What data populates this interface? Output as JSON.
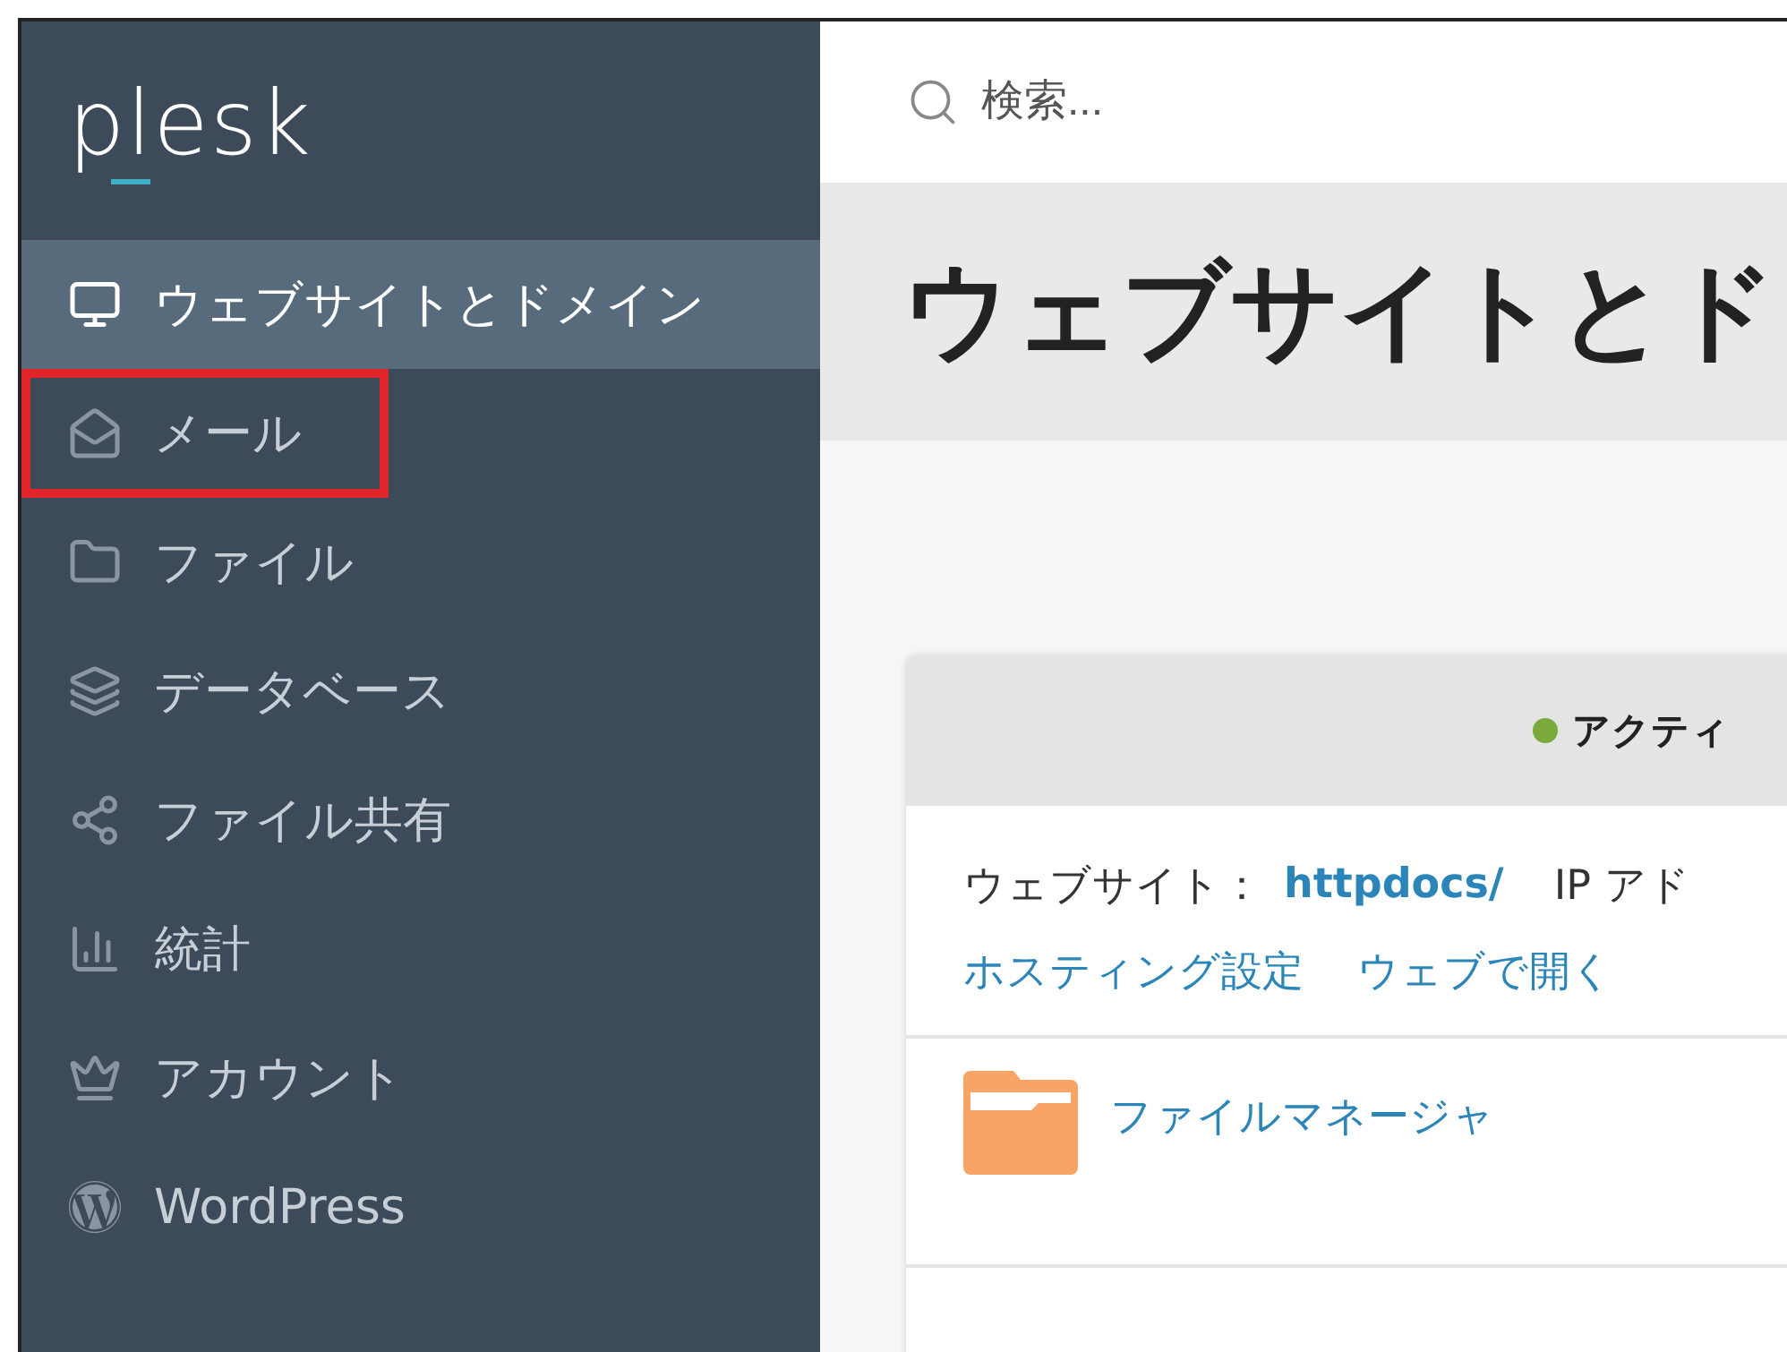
{
  "logo": "plesk",
  "search": {
    "placeholder": "検索..."
  },
  "sidebar": {
    "items": [
      {
        "label": "ウェブサイトとドメイン",
        "kind": "monitor",
        "selected": true,
        "highlighted": false
      },
      {
        "label": "メール",
        "kind": "mail",
        "selected": false,
        "highlighted": true
      },
      {
        "label": "ファイル",
        "kind": "folder",
        "selected": false,
        "highlighted": false
      },
      {
        "label": "データベース",
        "kind": "layers",
        "selected": false,
        "highlighted": false
      },
      {
        "label": "ファイル共有",
        "kind": "share",
        "selected": false,
        "highlighted": false
      },
      {
        "label": "統計",
        "kind": "chart",
        "selected": false,
        "highlighted": false
      },
      {
        "label": "アカウント",
        "kind": "crown",
        "selected": false,
        "highlighted": false
      },
      {
        "label": "WordPress",
        "kind": "wordpress",
        "selected": false,
        "highlighted": false
      }
    ]
  },
  "page_title": "ウェブサイトとド",
  "card": {
    "status": {
      "label": "アクティ",
      "color": "#7aab3a"
    },
    "website_label": "ウェブサイト：",
    "website_link": "httpdocs/",
    "ip_label": "IP アド",
    "links": [
      "ホスティング設定",
      "ウェブで開く"
    ],
    "tools": [
      {
        "label": "ファイルマネージャ"
      }
    ]
  }
}
